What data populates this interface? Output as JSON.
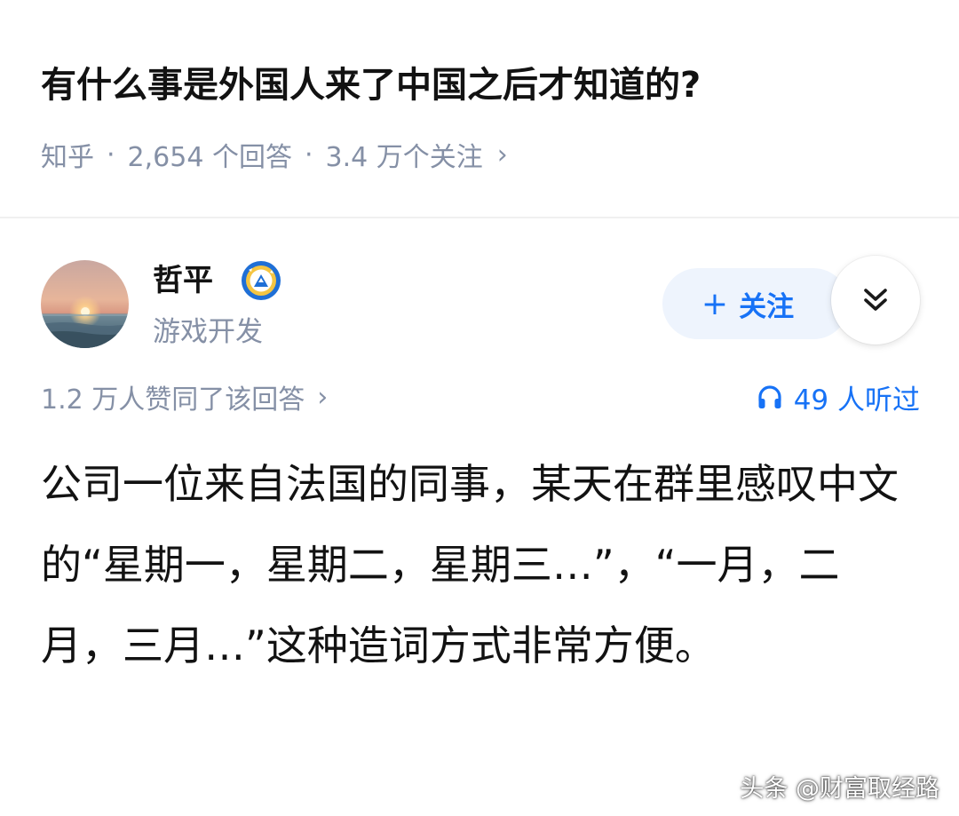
{
  "question": {
    "title": "有什么事是外国人来了中国之后才知道的?",
    "source": "知乎",
    "separator": "·",
    "answers_count": "2,654 个回答",
    "followers_count": "3.4 万个关注",
    "chevron": "›"
  },
  "author": {
    "name": "哲平",
    "bio": "游戏开发",
    "avatar_icon": "sunset-sea-avatar",
    "badge_icon": "creator-badge-icon"
  },
  "actions": {
    "follow_plus": "+",
    "follow_label": "关注",
    "expand_icon": "double-chevron-down-icon"
  },
  "stats": {
    "likes": "1.2 万人赞同了该回答",
    "chevron": "›",
    "listen_icon": "headphones-icon",
    "listeners": "49 人听过"
  },
  "answer": {
    "text": "公司一位来自法国的同事，某天在群里感叹中文的“星期一，星期二，星期三…”，“一月，二月，三月…”这种造词方式非常方便。"
  },
  "watermark": "头条 @财富取经路",
  "colors": {
    "accent": "#1772f6",
    "follow_bg": "#eef4fd",
    "meta_gray": "#8590a6",
    "text": "#121212"
  }
}
